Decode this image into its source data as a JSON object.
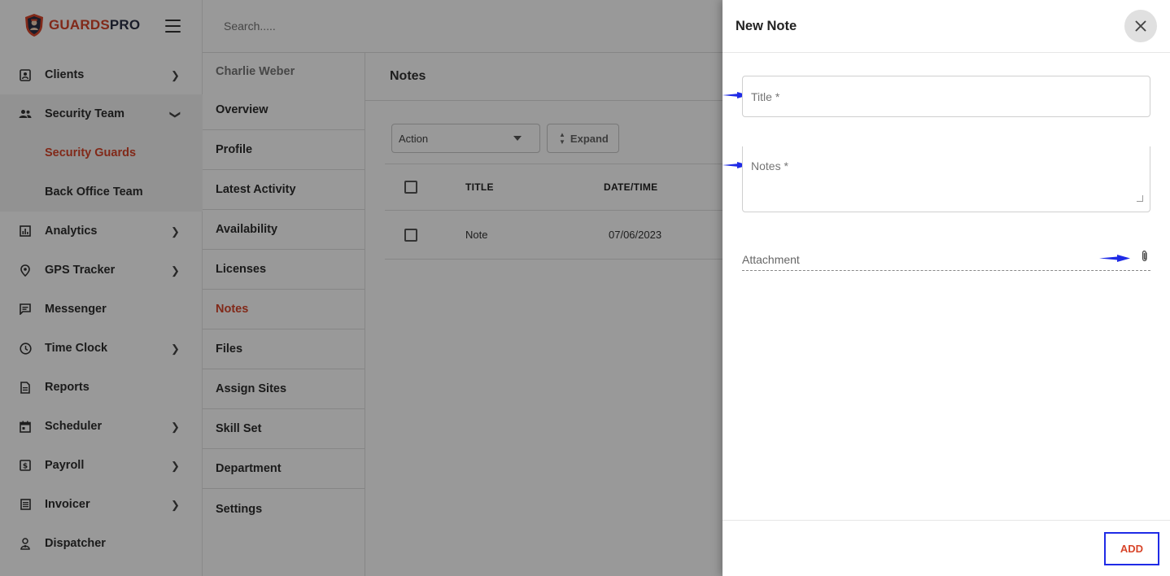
{
  "brand": {
    "name_part1": "GUARDS",
    "name_part2": "PRO"
  },
  "search": {
    "placeholder": "Search....."
  },
  "sidebar": {
    "items": [
      {
        "label": "Clients",
        "icon": "clients-icon",
        "has_chevron": true
      },
      {
        "label": "Security Team",
        "icon": "people-icon",
        "expanded": true
      },
      {
        "label": "Analytics",
        "icon": "analytics-icon",
        "has_chevron": true
      },
      {
        "label": "GPS Tracker",
        "icon": "location-pin-icon",
        "has_chevron": true
      },
      {
        "label": "Messenger",
        "icon": "message-icon",
        "has_chevron": false
      },
      {
        "label": "Time Clock",
        "icon": "clock-icon",
        "has_chevron": true
      },
      {
        "label": "Reports",
        "icon": "report-icon",
        "has_chevron": false
      },
      {
        "label": "Scheduler",
        "icon": "calendar-icon",
        "has_chevron": true
      },
      {
        "label": "Payroll",
        "icon": "payroll-icon",
        "has_chevron": true
      },
      {
        "label": "Invoicer",
        "icon": "invoice-icon",
        "has_chevron": true
      },
      {
        "label": "Dispatcher",
        "icon": "dispatcher-icon",
        "has_chevron": false
      }
    ],
    "sub_items": [
      {
        "label": "Security Guards",
        "active": true
      },
      {
        "label": "Back Office Team",
        "active": false
      }
    ]
  },
  "profile_nav": {
    "person_name": "Charlie Weber",
    "items": [
      "Overview",
      "Profile",
      "Latest Activity",
      "Availability",
      "Licenses",
      "Notes",
      "Files",
      "Assign Sites",
      "Skill Set",
      "Department",
      "Settings"
    ],
    "active": "Notes"
  },
  "main": {
    "title": "Notes",
    "action_label": "Action",
    "expand_label": "Expand",
    "columns": [
      "TITLE",
      "DATE/TIME"
    ],
    "rows": [
      {
        "title": "Note",
        "datetime": "07/06/2023"
      }
    ]
  },
  "drawer": {
    "title": "New Note",
    "title_placeholder": "Title *",
    "notes_placeholder": "Notes *",
    "attachment_label": "Attachment",
    "add_label": "ADD"
  },
  "colors": {
    "accent": "#d8452a",
    "brand_dark": "#2b2f45",
    "annotation_blue": "#1f2be6"
  }
}
